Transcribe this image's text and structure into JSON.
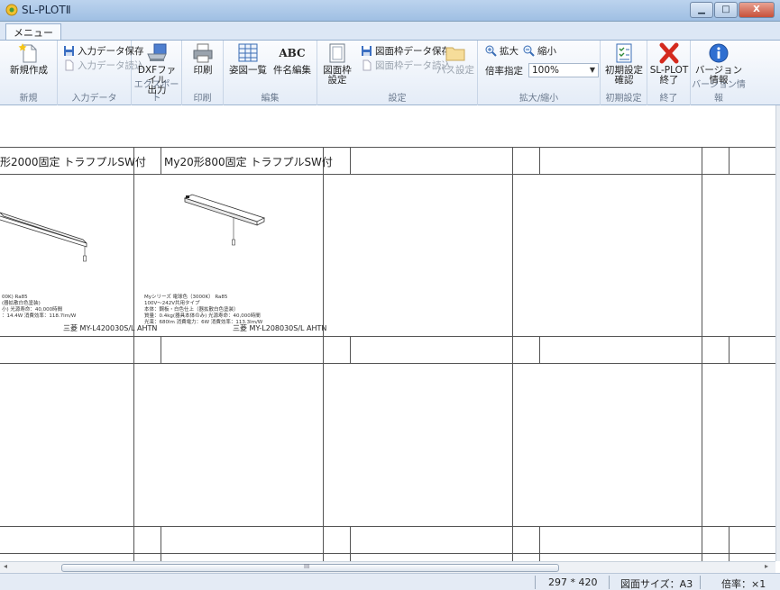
{
  "window": {
    "title": "SL-PLOTⅡ",
    "minimize": "▁",
    "maximize": "□",
    "close": "X"
  },
  "tabs": {
    "menu": "メニュー"
  },
  "ribbon": {
    "new": {
      "label": "新規作成",
      "group": "新規"
    },
    "input": {
      "save": "入力データ保存",
      "load": "入力データ読込",
      "group": "入力データ"
    },
    "export": {
      "dxf_line1": "DXFファイル",
      "dxf_line2": "出力",
      "group": "エクスポート"
    },
    "print": {
      "label": "印刷",
      "group": "印刷"
    },
    "edit": {
      "list": "姿図一覧",
      "abc": "ABC",
      "name_edit": "件名編集",
      "group": "編集"
    },
    "settings": {
      "frame_line1": "図面枠",
      "frame_line2": "設定",
      "frame_save": "図面枠データ保存",
      "frame_load": "図面枠データ読込",
      "path": "パス設定",
      "group": "設定"
    },
    "zoom": {
      "zoom_in": "拡大",
      "zoom_out": "縮小",
      "ratio_label": "倍率指定",
      "ratio_value": "100%",
      "group": "拡大/縮小"
    },
    "init": {
      "line1": "初期設定",
      "line2": "確認",
      "group": "初期設定"
    },
    "exit": {
      "line1": "SL-PLOT",
      "line2": "終了",
      "group": "終了"
    },
    "version": {
      "line1": "バージョン",
      "line2": "情報",
      "group": "バージョン情報"
    }
  },
  "drawing": {
    "cell1_title": "形2000固定 トラフプルSW付",
    "cell2_title": "My20形800固定 トラフプルSW付",
    "cell1_spec": [
      "00K)  Ra85",
      "",
      "(器拡散白色塗装)",
      "小) 光源寿命：40,000時間",
      "：14.4W 消費効率：118.7lm/W"
    ],
    "cell1_model": "三菱 MY-L420030S/L AHTN",
    "cell2_spec": [
      "Myシリーズ 電球色（3000K） Ra85",
      "100V～242V共用タイプ",
      "本体：鋼板・白色仕上（器拡散白色塗装）",
      "質量：0.4kg(器具本体のみ) 光源寿命：40,000時間",
      "光束：680lm 消費電力：6W 消費効率：113.3lm/W"
    ],
    "cell2_model": "三菱 MY-L208030S/L AHTN"
  },
  "scrollbar": {
    "thumb_marker": "III",
    "left_arrow": "◂",
    "right_arrow": "▸"
  },
  "status": {
    "size": "297 * 420",
    "paper": "図面サイズ：A3",
    "scale": "倍率：×1"
  }
}
